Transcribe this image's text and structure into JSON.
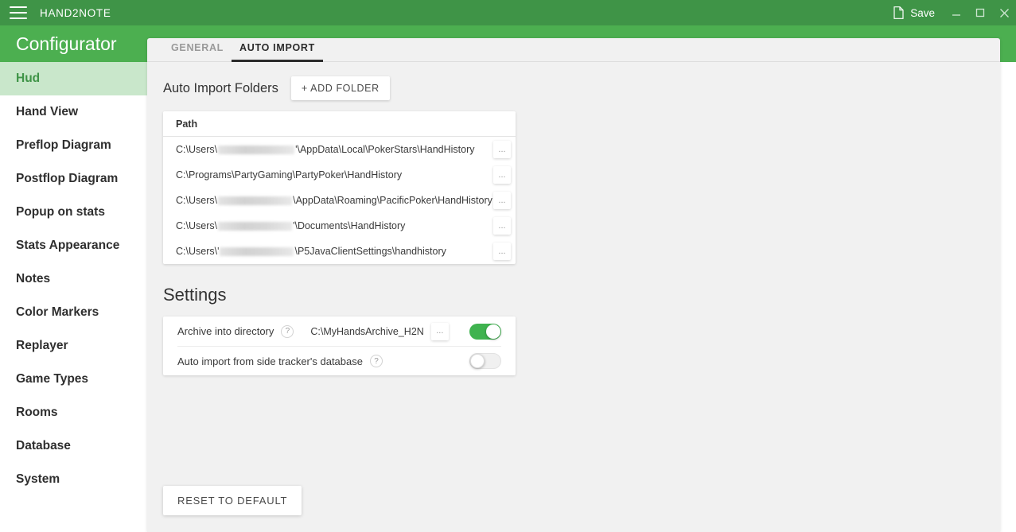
{
  "titlebar": {
    "menu_icon": "hamburger-icon",
    "app_title": "HAND2NOTE",
    "save_label": "Save",
    "save_icon": "document-icon",
    "minimize_icon": "minimize-icon",
    "maximize_icon": "maximize-icon",
    "close_icon": "close-icon"
  },
  "sidebar": {
    "title": "Configurator",
    "items": [
      {
        "label": "Hud",
        "active": true
      },
      {
        "label": "Hand View",
        "active": false
      },
      {
        "label": "Preflop Diagram",
        "active": false
      },
      {
        "label": "Postflop Diagram",
        "active": false
      },
      {
        "label": "Popup on stats",
        "active": false
      },
      {
        "label": "Stats Appearance",
        "active": false
      },
      {
        "label": "Notes",
        "active": false
      },
      {
        "label": "Color Markers",
        "active": false
      },
      {
        "label": "Replayer",
        "active": false
      },
      {
        "label": "Game Types",
        "active": false
      },
      {
        "label": "Rooms",
        "active": false
      },
      {
        "label": "Database",
        "active": false
      },
      {
        "label": "System",
        "active": false
      }
    ]
  },
  "tabs": [
    {
      "label": "GENERAL",
      "active": false
    },
    {
      "label": "AUTO IMPORT",
      "active": true
    }
  ],
  "folders_section": {
    "title": "Auto Import Folders",
    "add_button": "+ ADD FOLDER",
    "column_header": "Path",
    "browse_button": "...",
    "rows": [
      {
        "prefix": "C:\\Users\\",
        "redacted": true,
        "suffix": "'\\AppData\\Local\\PokerStars\\HandHistory"
      },
      {
        "prefix": "C:\\Programs\\PartyGaming\\PartyPoker\\HandHistory",
        "redacted": false,
        "suffix": ""
      },
      {
        "prefix": "C:\\Users\\",
        "redacted": true,
        "suffix": "\\AppData\\Roaming\\PacificPoker\\HandHistory"
      },
      {
        "prefix": "C:\\Users\\",
        "redacted": true,
        "suffix": "'\\Documents\\HandHistory"
      },
      {
        "prefix": "C:\\Users\\'",
        "redacted": true,
        "suffix": "\\P5JavaClientSettings\\handhistory"
      }
    ]
  },
  "settings_section": {
    "title": "Settings",
    "help_glyph": "?",
    "browse_button": "...",
    "rows": [
      {
        "label": "Archive into directory",
        "value": "C:\\MyHandsArchive_H2N",
        "has_browse": true,
        "toggle_on": true
      },
      {
        "label": "Auto import from side tracker's database",
        "value": "",
        "has_browse": false,
        "toggle_on": false
      }
    ]
  },
  "footer": {
    "reset_button": "RESET TO DEFAULT"
  },
  "colors": {
    "titlebar_green": "#3f9447",
    "band_green": "#4caf50",
    "active_nav_bg": "#c9e7cb",
    "active_nav_text": "#3f9447",
    "panel_bg": "#f1f1f1",
    "toggle_on": "#3fb34f"
  }
}
